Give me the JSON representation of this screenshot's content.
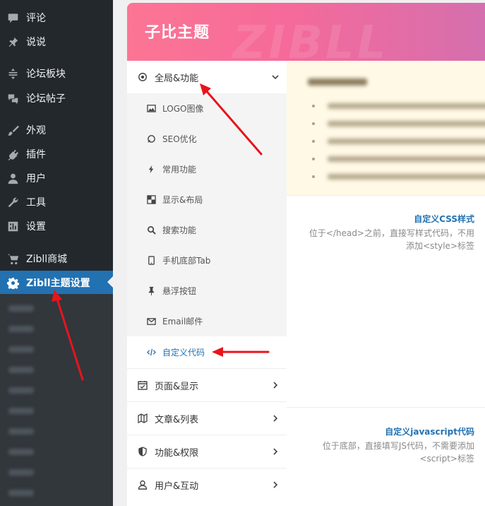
{
  "wp_menu": {
    "items": [
      {
        "label": "评论",
        "icon": "comment-icon"
      },
      {
        "label": "说说",
        "icon": "pin-icon"
      },
      {
        "label": "论坛板块",
        "icon": "forum-section-icon"
      },
      {
        "label": "论坛帖子",
        "icon": "forum-post-icon"
      },
      {
        "label": "外观",
        "icon": "brush-icon"
      },
      {
        "label": "插件",
        "icon": "plugin-icon"
      },
      {
        "label": "用户",
        "icon": "user-icon"
      },
      {
        "label": "工具",
        "icon": "wrench-icon"
      },
      {
        "label": "设置",
        "icon": "settings-icon"
      },
      {
        "label": "Zibll商城",
        "icon": "cart-icon"
      },
      {
        "label": "Zibll主题设置",
        "icon": "gear-icon"
      }
    ]
  },
  "panel": {
    "banner_title": "子比主题",
    "banner_watermark": "ZIBLL"
  },
  "nav": {
    "top": {
      "label": "全局&功能",
      "icon": "target-icon"
    },
    "sub_items": [
      {
        "label": "LOGO图像",
        "icon": "image-icon"
      },
      {
        "label": "SEO优化",
        "icon": "seo-icon"
      },
      {
        "label": "常用功能",
        "icon": "bolt-icon"
      },
      {
        "label": "显示&布局",
        "icon": "layout-icon"
      },
      {
        "label": "搜索功能",
        "icon": "search-icon"
      },
      {
        "label": "手机底部Tab",
        "icon": "mobile-icon"
      },
      {
        "label": "悬浮按钮",
        "icon": "pushpin-icon"
      },
      {
        "label": "Email邮件",
        "icon": "email-icon"
      },
      {
        "label": "自定义代码",
        "icon": "code-icon"
      }
    ],
    "groups": [
      {
        "label": "页面&显示",
        "icon": "calendar-check-icon"
      },
      {
        "label": "文章&列表",
        "icon": "map-icon"
      },
      {
        "label": "功能&权限",
        "icon": "shield-icon"
      },
      {
        "label": "用户&互动",
        "icon": "user-outline-icon"
      }
    ]
  },
  "content": {
    "css_field": {
      "title": "自定义CSS样式",
      "desc": "位于</head>之前，直接写样式代码，不用添加<style>标签"
    },
    "js_field": {
      "title": "自定义javascript代码",
      "desc": "位于底部，直接填写JS代码，不需要添加<script>标签"
    }
  },
  "colors": {
    "accent": "#2271b1",
    "sidebar_bg": "#23282d",
    "banner_start": "#fc7594",
    "banner_end": "#d56fae",
    "arrow": "#e8141c"
  }
}
